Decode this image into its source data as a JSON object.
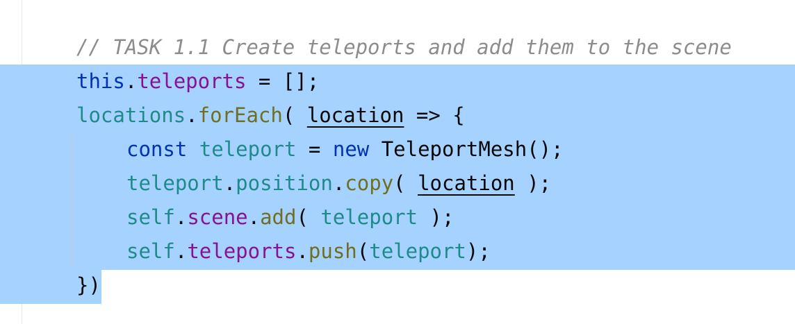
{
  "editor": {
    "lines": [
      {
        "tokens": [
          {
            "text": "// TASK 1.1 Create teleports and add them to the scene"
          }
        ]
      },
      {
        "tokens": [
          {
            "text": "this"
          },
          {
            "text": "."
          },
          {
            "text": "teleports"
          },
          {
            "text": " = [];"
          }
        ]
      },
      {
        "tokens": [
          {
            "text": "locations"
          },
          {
            "text": "."
          },
          {
            "text": "forEach"
          },
          {
            "text": "( "
          },
          {
            "text": "location"
          },
          {
            "text": " => {"
          }
        ]
      },
      {
        "tokens": [
          {
            "text": "const"
          },
          {
            "text": " "
          },
          {
            "text": "teleport"
          },
          {
            "text": " = "
          },
          {
            "text": "new"
          },
          {
            "text": " TeleportMesh();"
          }
        ]
      },
      {
        "tokens": [
          {
            "text": "teleport"
          },
          {
            "text": "."
          },
          {
            "text": "position"
          },
          {
            "text": "."
          },
          {
            "text": "copy"
          },
          {
            "text": "( "
          },
          {
            "text": "location"
          },
          {
            "text": " );"
          }
        ]
      },
      {
        "tokens": [
          {
            "text": "self"
          },
          {
            "text": "."
          },
          {
            "text": "scene"
          },
          {
            "text": "."
          },
          {
            "text": "add"
          },
          {
            "text": "( "
          },
          {
            "text": "teleport"
          },
          {
            "text": " );"
          }
        ]
      },
      {
        "tokens": [
          {
            "text": "self"
          },
          {
            "text": "."
          },
          {
            "text": "teleports"
          },
          {
            "text": "."
          },
          {
            "text": "push"
          },
          {
            "text": "("
          },
          {
            "text": "teleport"
          },
          {
            "text": ");"
          }
        ]
      },
      {
        "tokens": [
          {
            "text": "})"
          }
        ]
      }
    ],
    "colors": {
      "selection": "#a6d2ff",
      "comment": "#8c8c8c",
      "keyword": "#0033b3",
      "field": "#871094",
      "identifier": "#1f8a8a",
      "method": "#6f6f21",
      "text": "#080808"
    }
  }
}
